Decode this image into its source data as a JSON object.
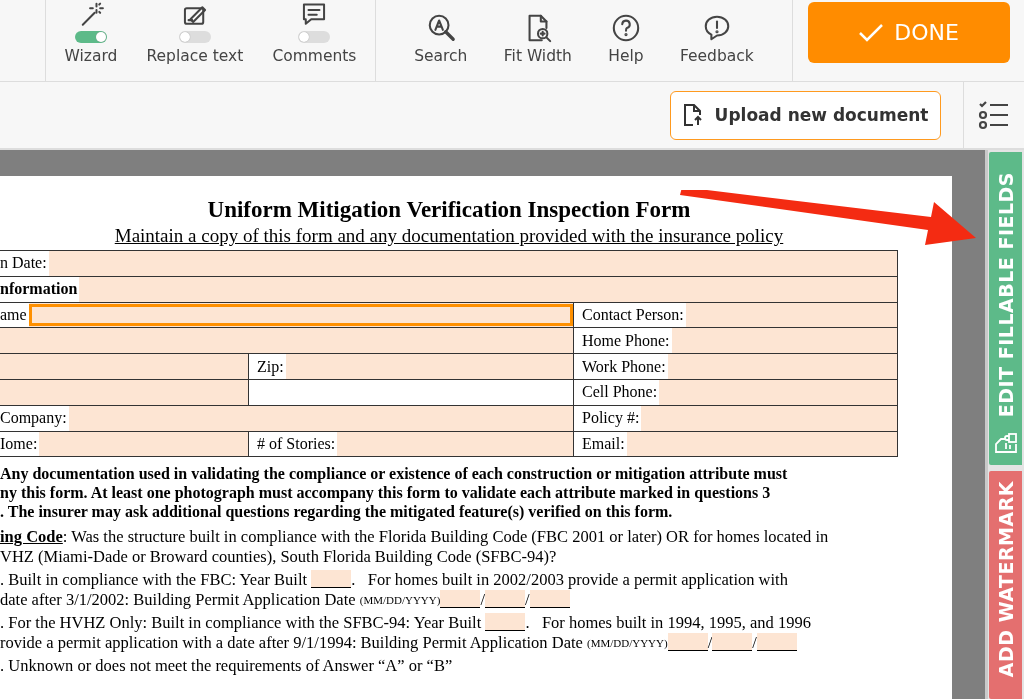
{
  "toolbar": {
    "modes": [
      {
        "label": "Wizard",
        "on": true
      },
      {
        "label": "Replace text",
        "on": false
      },
      {
        "label": "Comments",
        "on": false
      }
    ],
    "tools": [
      {
        "label": "Search"
      },
      {
        "label": "Fit Width"
      },
      {
        "label": "Help"
      },
      {
        "label": "Feedback"
      }
    ],
    "done": {
      "label": "DONE"
    }
  },
  "subbar": {
    "upload": {
      "label": "Upload new document"
    }
  },
  "document": {
    "title": "Uniform Mitigation Verification Inspection Form",
    "subtitle": "Maintain a copy of this form and any documentation provided with the insurance policy",
    "table": [
      {
        "kind": "full",
        "cells": [
          {
            "kind": "field",
            "label": "n Date:",
            "focused": false
          }
        ]
      },
      {
        "kind": "full",
        "cells": [
          {
            "kind": "heading",
            "label": "nformation",
            "focused": false
          }
        ]
      },
      {
        "kind": "wide",
        "cells": [
          {
            "kind": "field",
            "label": "ame",
            "focused": true
          },
          {
            "kind": "field",
            "label": "Contact Person:",
            "focused": false
          }
        ]
      },
      {
        "kind": "wide",
        "cells": [
          {
            "kind": "field",
            "focused": false
          },
          {
            "kind": "field",
            "label": "Home Phone:",
            "focused": false
          }
        ]
      },
      {
        "kind": "split",
        "cells": [
          {
            "kind": "field",
            "focused": false
          },
          {
            "kind": "field",
            "label": "Zip:",
            "focused": false
          },
          {
            "kind": "field",
            "label": "Work Phone:",
            "focused": false
          }
        ]
      },
      {
        "kind": "split",
        "cells": [
          {
            "kind": "field",
            "focused": false
          },
          {
            "kind": "empty",
            "focused": false
          },
          {
            "kind": "field",
            "label": "Cell Phone:",
            "focused": false
          }
        ]
      },
      {
        "kind": "wide",
        "cells": [
          {
            "kind": "field",
            "label": " Company:",
            "focused": false
          },
          {
            "kind": "field",
            "label": "Policy #:",
            "focused": false
          }
        ]
      },
      {
        "kind": "split",
        "cells": [
          {
            "kind": "field",
            "label": "Iome:",
            "focused": false
          },
          {
            "kind": "field",
            "label": "# of Stories:",
            "focused": false
          },
          {
            "kind": "field",
            "label": "Email:",
            "focused": false
          }
        ]
      }
    ],
    "notice": [
      "Any documentation used in validating the compliance or existence of each construction or mitigation attribute must",
      "ny this form.  At least one photograph must accompany this form to validate each attribute marked in questions 3",
      ".  The insurer may ask additional questions regarding the mitigated feature(s) verified on this form."
    ],
    "question": {
      "heading": "ing Code",
      "lines": [
        ":  Was the structure built in compliance with the Florida Building Code (FBC 2001 or later) OR for homes located in",
        "VHZ (Miami-Dade or Broward counties), South Florida Building Code (SFBC-94)?"
      ]
    },
    "answers": [
      {
        "lines": [
          [
            {
              "kind": "text",
              "text": ". Built in compliance with the FBC: Year Built "
            },
            {
              "kind": "blank"
            },
            {
              "kind": "text",
              "text": ".   For homes built in 2002/2003 provide a permit application with"
            }
          ],
          [
            {
              "kind": "text",
              "text": "date after 3/1/2002: Building Permit Application Date "
            },
            {
              "kind": "small",
              "text": "(MM/DD/YYYY)"
            },
            {
              "kind": "blank"
            },
            {
              "kind": "text",
              "text": "/"
            },
            {
              "kind": "blank"
            },
            {
              "kind": "text",
              "text": "/"
            },
            {
              "kind": "blank"
            }
          ]
        ]
      },
      {
        "lines": [
          [
            {
              "kind": "text",
              "text": ". For the HVHZ Only: Built in compliance with the SFBC-94: Year Built "
            },
            {
              "kind": "blank"
            },
            {
              "kind": "text",
              "text": ".   For homes built in 1994, 1995, and 1996"
            }
          ],
          [
            {
              "kind": "text",
              "text": "rovide a permit application with a date after 9/1/1994: Building Permit Application Date "
            },
            {
              "kind": "small",
              "text": "(MM/DD/YYYY)"
            },
            {
              "kind": "blank"
            },
            {
              "kind": "text",
              "text": "/"
            },
            {
              "kind": "blank"
            },
            {
              "kind": "text",
              "text": "/"
            },
            {
              "kind": "blank"
            }
          ]
        ]
      },
      {
        "lines": [
          [
            {
              "kind": "text",
              "text": ". Unknown or does not meet the requirements of Answer “A” or “B”"
            }
          ]
        ]
      }
    ]
  },
  "side_tabs": [
    {
      "label": "EDIT FILLABLE FIELDS",
      "color": "#5dba89"
    },
    {
      "label": "ADD WATERMARK",
      "color": "#e46f6f"
    }
  ]
}
